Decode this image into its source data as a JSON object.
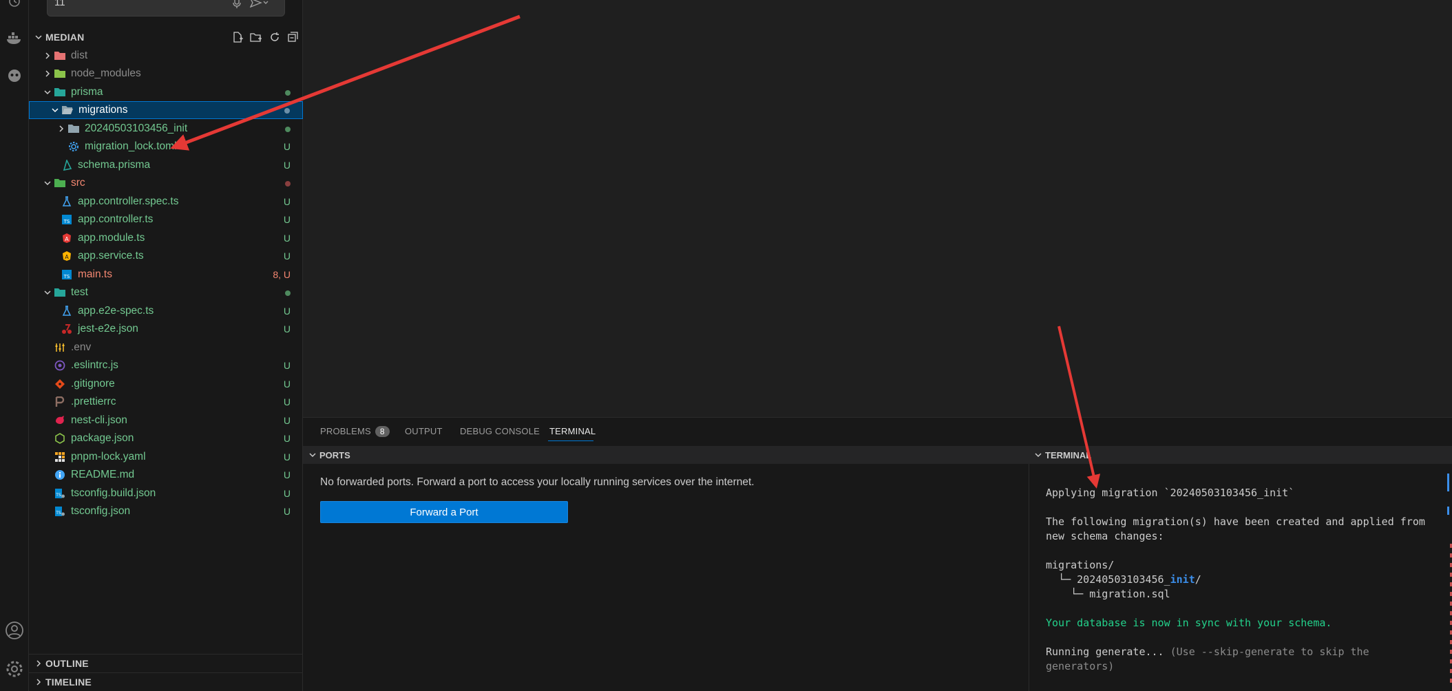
{
  "chat": {
    "input_value": "11"
  },
  "explorer": {
    "title": "MEDIAN",
    "items": [
      {
        "label": "dist",
        "kind": "folder",
        "status": ""
      },
      {
        "label": "node_modules",
        "kind": "folder",
        "status": ""
      },
      {
        "label": "prisma",
        "kind": "folder",
        "status": ""
      },
      {
        "label": "migrations",
        "kind": "folder-open",
        "status": ""
      },
      {
        "label": "20240503103456_init",
        "kind": "folder",
        "status": ""
      },
      {
        "label": "migration_lock.toml",
        "kind": "toml",
        "status": "U"
      },
      {
        "label": "schema.prisma",
        "kind": "prisma",
        "status": "U"
      },
      {
        "label": "src",
        "kind": "folder",
        "status": ""
      },
      {
        "label": "app.controller.spec.ts",
        "kind": "test",
        "status": "U"
      },
      {
        "label": "app.controller.ts",
        "kind": "ts",
        "status": "U"
      },
      {
        "label": "app.module.ts",
        "kind": "nest",
        "status": "U"
      },
      {
        "label": "app.service.ts",
        "kind": "angular",
        "status": "U"
      },
      {
        "label": "main.ts",
        "kind": "ts",
        "status": "8, U"
      },
      {
        "label": "test",
        "kind": "folder",
        "status": ""
      },
      {
        "label": "app.e2e-spec.ts",
        "kind": "test",
        "status": "U"
      },
      {
        "label": "jest-e2e.json",
        "kind": "jest",
        "status": "U"
      },
      {
        "label": ".env",
        "kind": "env",
        "status": ""
      },
      {
        "label": ".eslintrc.js",
        "kind": "eslint",
        "status": "U"
      },
      {
        "label": ".gitignore",
        "kind": "git",
        "status": "U"
      },
      {
        "label": ".prettierrc",
        "kind": "prettier",
        "status": "U"
      },
      {
        "label": "nest-cli.json",
        "kind": "nest",
        "status": "U"
      },
      {
        "label": "package.json",
        "kind": "node",
        "status": "U"
      },
      {
        "label": "pnpm-lock.yaml",
        "kind": "pnpm",
        "status": "U"
      },
      {
        "label": "README.md",
        "kind": "info",
        "status": "U"
      },
      {
        "label": "tsconfig.build.json",
        "kind": "tsconfig",
        "status": "U"
      },
      {
        "label": "tsconfig.json",
        "kind": "tsconfig",
        "status": "U"
      }
    ]
  },
  "outline": {
    "title": "OUTLINE"
  },
  "timeline": {
    "title": "TIMELINE"
  },
  "panel": {
    "tabs": {
      "problems": "PROBLEMS",
      "problems_count": "8",
      "output": "OUTPUT",
      "debug_console": "DEBUG CONSOLE",
      "terminal": "TERMINAL"
    },
    "ports": {
      "title": "PORTS",
      "message": "No forwarded ports. Forward a port to access your locally running services over the internet.",
      "button": "Forward a Port"
    },
    "terminal": {
      "title": "TERMINAL",
      "line1": "Applying migration `20240503103456_init`",
      "line2": "The following migration(s) have been created and applied from new schema changes:",
      "line3": "migrations/",
      "line4a": "  └─ 20240503103456_",
      "line4b": "init",
      "line4c": "/",
      "line5": "    └─ migration.sql",
      "line6": "Your database is now in sync with your schema.",
      "line7a": "Running generate... ",
      "line7b": "(Use --skip-generate to skip the generators)"
    }
  },
  "colors": {
    "accent": "#0078d4",
    "untracked": "#73c991",
    "error": "#f48771",
    "annotation_arrow": "#e53935"
  }
}
